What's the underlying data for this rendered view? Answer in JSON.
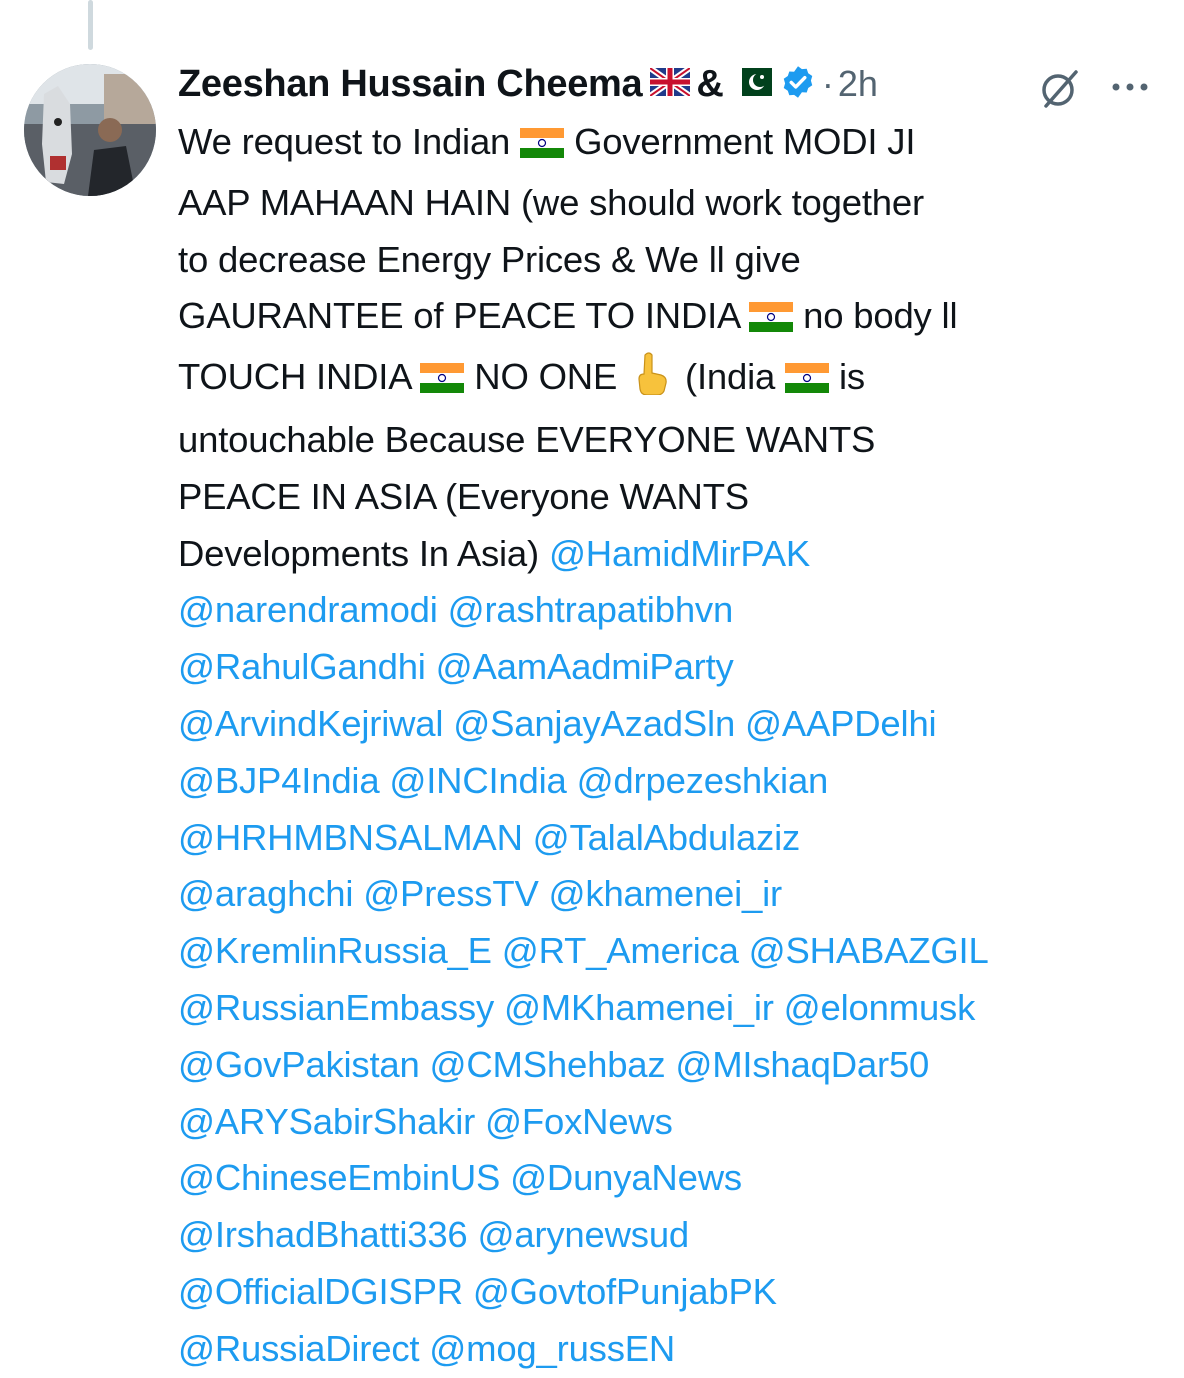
{
  "author": {
    "display_name": "Zeeshan Hussain Cheema",
    "amp": "&",
    "separator": "·",
    "time_ago": "2h"
  },
  "icons": {
    "avatar": "avatar-photo",
    "flag_uk": "uk-flag-icon",
    "flag_pk": "pakistan-flag-icon",
    "verified": "verified-badge-icon",
    "grok": "grok-icon",
    "more": "more-icon",
    "flag_in": "india-flag-icon",
    "finger": "index-pointing-up-icon"
  },
  "colors": {
    "text": "#0f1419",
    "muted": "#536471",
    "mention": "#1d9bf0"
  },
  "tweet": {
    "l1a": "We request to Indian",
    "l1b": "Government MODI JI",
    "l2": "AAP MAHAAN HAIN (we should work together",
    "l3": "to decrease Energy Prices & We ll give",
    "l4a": "GAURANTEE of PEACE TO INDIA",
    "l4b": "no body ll",
    "l5a": "TOUCH INDIA",
    "l5b": "NO ONE",
    "l5c": "(India",
    "l5d": "is",
    "l6": "untouchable Because EVERYONE WANTS",
    "l7": "PEACE IN ASIA (Everyone WANTS",
    "l8a": "Developments In Asia)",
    "m1": "@HamidMirPAK",
    "m2": "@narendramodi @rashtrapatibhvn",
    "m3": "@RahulGandhi  @AamAadmiParty",
    "m4": "@ArvindKejriwal  @SanjayAzadSln @AAPDelhi",
    "m5": "@BJP4India @INCIndia @drpezeshkian",
    "m6": "@HRHMBNSALMAN @TalalAbdulaziz",
    "m7": "@araghchi @PressTV @khamenei_ir",
    "m8": "@KremlinRussia_E @RT_America @SHABAZGIL",
    "m9": "@RussianEmbassy @MKhamenei_ir @elonmusk",
    "m10": "@GovPakistan @CMShehbaz  @MIshaqDar50",
    "m11": "@ARYSabirShakir @FoxNews",
    "m12": "@ChineseEmbinUS @DunyaNews",
    "m13": "@IrshadBhatti336 @arynewsud",
    "m14": "@OfficialDGISPR @GovtofPunjabPK",
    "m15": "@RussiaDirect @mog_russEN"
  }
}
